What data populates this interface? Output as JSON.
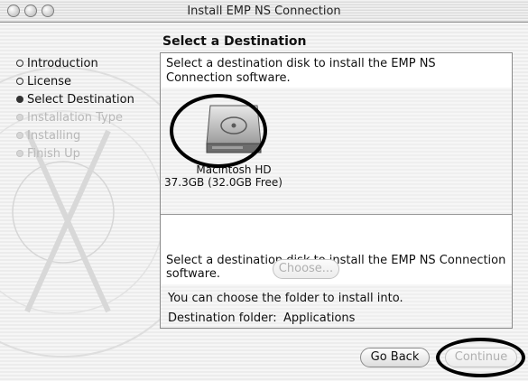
{
  "window": {
    "title": "Install EMP NS Connection"
  },
  "section_title": "Select a Destination",
  "sidebar": {
    "steps": [
      {
        "label": "Introduction",
        "state": "done"
      },
      {
        "label": "License",
        "state": "done"
      },
      {
        "label": "Select Destination",
        "state": "current"
      },
      {
        "label": "Installation Type",
        "state": "disabled"
      },
      {
        "label": "Installing",
        "state": "disabled"
      },
      {
        "label": "Finish Up",
        "state": "disabled"
      }
    ]
  },
  "panel": {
    "intro": "Select a destination disk to install the EMP NS Connection software.",
    "disk": {
      "name": "Macintosh HD",
      "size": "37.3GB (32.0GB Free)",
      "icon": "hard-drive-icon"
    },
    "destination_message": "Select a destination disk to install the EMP NS Connection software.",
    "folder_note": "You can choose the folder to install into.",
    "folder_label": "Destination folder:",
    "folder_value": "Applications"
  },
  "buttons": {
    "choose": "Choose...",
    "go_back": "Go Back",
    "continue": "Continue"
  },
  "colors": {
    "disabled_text": "#b8b8b8",
    "annotation_ring": "#000000"
  }
}
